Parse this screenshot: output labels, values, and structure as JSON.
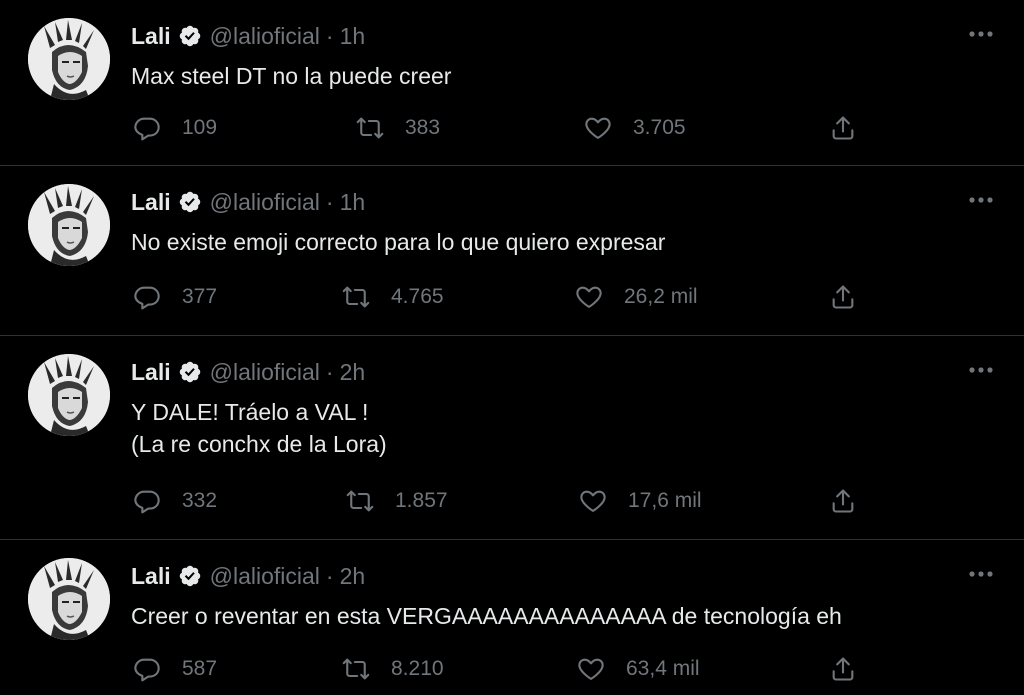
{
  "tweets": [
    {
      "name": "Lali",
      "handle": "@lalioficial",
      "separator": "·",
      "time": "1h",
      "text": "Max steel DT no la puede creer",
      "replies": "109",
      "retweets": "383",
      "likes": "3.705"
    },
    {
      "name": "Lali",
      "handle": "@lalioficial",
      "separator": "·",
      "time": "1h",
      "text": "No existe emoji correcto para lo que quiero expresar",
      "replies": "377",
      "retweets": "4.765",
      "likes": "26,2 mil"
    },
    {
      "name": "Lali",
      "handle": "@lalioficial",
      "separator": "·",
      "time": "2h",
      "text": "Y DALE! Tráelo a VAL !\n(La re conchx de la Lora)",
      "replies": "332",
      "retweets": "1.857",
      "likes": "17,6 mil"
    },
    {
      "name": "Lali",
      "handle": "@lalioficial",
      "separator": "·",
      "time": "2h",
      "text": "Creer o reventar en esta VERGAAAAAAAAAAAAAA de tecnología eh",
      "replies": "587",
      "retweets": "8.210",
      "likes": "63,4 mil"
    }
  ],
  "icons": {
    "verified": "verified-badge-icon",
    "more": "more-options-icon",
    "reply": "reply-icon",
    "retweet": "retweet-icon",
    "like": "like-icon",
    "share": "share-icon"
  },
  "colors": {
    "background": "#000000",
    "text_primary": "#e7e9ea",
    "text_secondary": "#71767b",
    "divider": "#2f3336"
  }
}
